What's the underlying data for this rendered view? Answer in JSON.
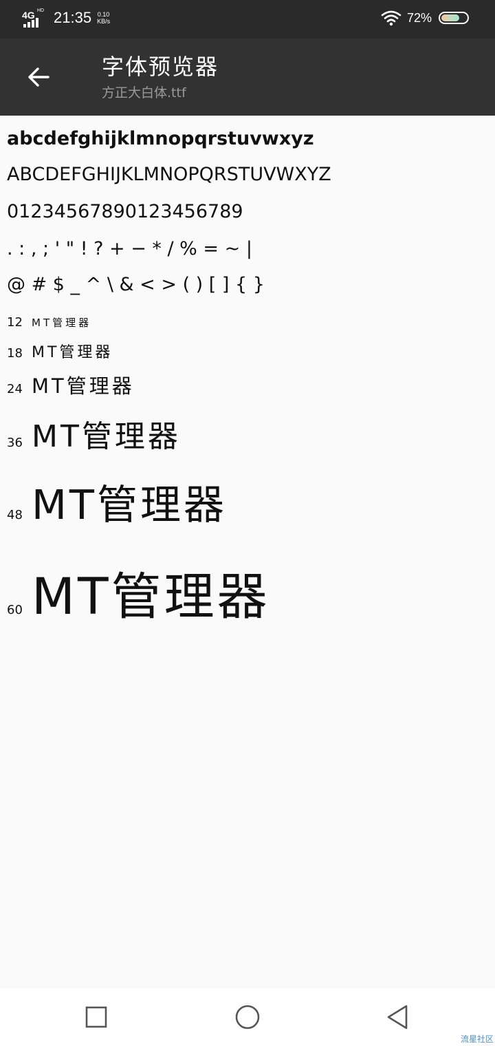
{
  "status_bar": {
    "network": "4G",
    "network_suffix": "HD",
    "time": "21:35",
    "speed_value": "0.10",
    "speed_unit": "KB/s",
    "battery_percent": "72%",
    "battery_level": 0.72
  },
  "app_bar": {
    "back_icon": "arrow-left-icon",
    "title": "字体预览器",
    "subtitle": "方正大白体.ttf"
  },
  "preview": {
    "lowercase": "abcdefghijklmnopqrstuvwxyz",
    "uppercase": "ABCDEFGHIJKLMNOPQRSTUVWXYZ",
    "digits": "01234567890123456789",
    "punct1": ". : , ; ' \" ! ? + − * / % = ~ |",
    "punct2": "@ # $ _ ^ \\ & < > ( ) [ ] { }",
    "sample_text": "MT管理器",
    "sizes": [
      {
        "label": "12",
        "size": 12
      },
      {
        "label": "18",
        "size": 18
      },
      {
        "label": "24",
        "size": 24
      },
      {
        "label": "36",
        "size": 36
      },
      {
        "label": "48",
        "size": 48
      },
      {
        "label": "60",
        "size": 60
      }
    ]
  },
  "nav_bar": {
    "recents_icon": "square-icon",
    "home_icon": "circle-icon",
    "back_icon": "triangle-back-icon"
  },
  "watermark": "流星社区"
}
